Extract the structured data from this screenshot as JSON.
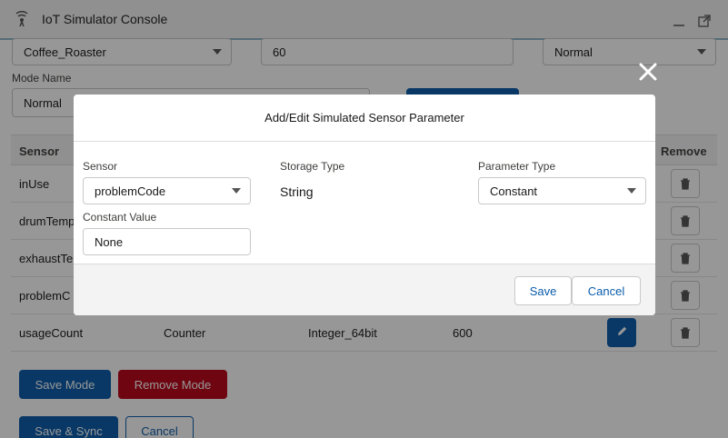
{
  "window": {
    "title": "IoT Simulator Console"
  },
  "background": {
    "top_fields": {
      "asset_select": "Coffee_Roaster",
      "value_field": "60",
      "mode_select": "Normal"
    },
    "mode_name_label": "Mode Name",
    "mode_name_value": "Normal",
    "table": {
      "headers": {
        "sensor": "Sensor",
        "remove": "Remove"
      },
      "rows": [
        {
          "sensor": "inUse"
        },
        {
          "sensor": "drumTemp"
        },
        {
          "sensor": "exhaustTe"
        },
        {
          "sensor": "problemC"
        },
        {
          "sensor": "usageCount",
          "type": "Counter",
          "storage": "Integer_64bit",
          "value": "600"
        }
      ]
    },
    "buttons": {
      "save_mode": "Save Mode",
      "remove_mode": "Remove Mode",
      "save_sync": "Save & Sync",
      "cancel": "Cancel"
    }
  },
  "modal": {
    "title": "Add/Edit Simulated Sensor Parameter",
    "sensor_label": "Sensor",
    "sensor_value": "problemCode",
    "storage_type_label": "Storage Type",
    "storage_type_value": "String",
    "parameter_type_label": "Parameter Type",
    "parameter_type_value": "Constant",
    "constant_value_label": "Constant Value",
    "constant_value": "None",
    "save_label": "Save",
    "cancel_label": "Cancel"
  },
  "colors": {
    "brand": "#0b5cab",
    "danger": "#ba0517"
  }
}
